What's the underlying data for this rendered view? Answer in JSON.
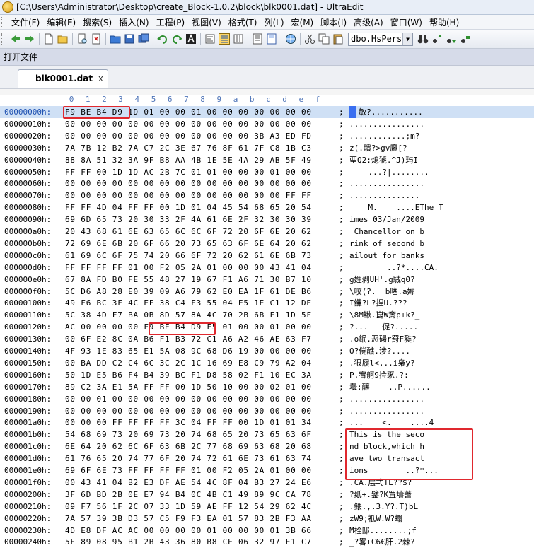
{
  "window": {
    "title": "[C:\\Users\\Administrator\\Desktop\\create_Block-1.0.2\\block\\blk0001.dat] - UltraEdit",
    "icon": "ultraedit-app-icon"
  },
  "menu": [
    {
      "label": "文件(F)",
      "icon": "file-menu-icon"
    },
    {
      "label": "编辑(E)"
    },
    {
      "label": "搜索(S)"
    },
    {
      "label": "插入(N)"
    },
    {
      "label": "工程(P)"
    },
    {
      "label": "视图(V)"
    },
    {
      "label": "格式(T)"
    },
    {
      "label": "列(L)"
    },
    {
      "label": "宏(M)"
    },
    {
      "label": "脚本(I)"
    },
    {
      "label": "高级(A)"
    },
    {
      "label": "窗口(W)"
    },
    {
      "label": "帮助(H)"
    }
  ],
  "toolbar": {
    "combo_value": "dbo.HsPerso"
  },
  "panel_label": "打开文件",
  "tab": {
    "label": "blk0001.dat",
    "close": "x"
  },
  "column_headers": [
    "0",
    "1",
    "2",
    "3",
    "4",
    "5",
    "6",
    "7",
    "8",
    "9",
    "a",
    "b",
    "c",
    "d",
    "e",
    "f"
  ],
  "hex_rows": [
    {
      "addr": "00000000h:",
      "bytes": "F9 BE B4 D9 1D 01 00 00 01 00 00 00 00 00 00 00",
      "ascii": "  敏?..........."
    },
    {
      "addr": "00000010h:",
      "bytes": "00 00 00 00 00 00 00 00 00 00 00 00 00 00 00 00",
      "ascii": "................"
    },
    {
      "addr": "00000020h:",
      "bytes": "00 00 00 00 00 00 00 00 00 00 00 00 3B A3 ED FD",
      "ascii": "............;m?"
    },
    {
      "addr": "00000030h:",
      "bytes": "7A 7B 12 B2 7A C7 2C 3E 67 76 8F 61 7F C8 1B C3",
      "ascii": "z(.瞶?>gv廲[?"
    },
    {
      "addr": "00000040h:",
      "bytes": "88 8A 51 32 3A 9F B8 AA 4B 1E 5E 4A 29 AB 5F 49",
      "ascii": "垔Q2:熄猇.^J)玙I"
    },
    {
      "addr": "00000050h:",
      "bytes": "FF FF 00 1D 1D AC 2B 7C 01 01 00 00 00 01 00 00",
      "ascii": "    ...?|........"
    },
    {
      "addr": "00000060h:",
      "bytes": "00 00 00 00 00 00 00 00 00 00 00 00 00 00 00 00",
      "ascii": "................"
    },
    {
      "addr": "00000070h:",
      "bytes": "00 00 00 00 00 00 00 00 00 00 00 00 00 00 FF FF",
      "ascii": "..............."
    },
    {
      "addr": "00000080h:",
      "bytes": "FF FF 4D 04 FF FF 00 1D 01 04 45 54 68 65 20 54",
      "ascii": "    M.    ....EThe T"
    },
    {
      "addr": "00000090h:",
      "bytes": "69 6D 65 73 20 30 33 2F 4A 61 6E 2F 32 30 30 39",
      "ascii": "imes 03/Jan/2009"
    },
    {
      "addr": "000000a0h:",
      "bytes": "20 43 68 61 6E 63 65 6C 6C 6F 72 20 6F 6E 20 62",
      "ascii": " Chancellor on b"
    },
    {
      "addr": "000000b0h:",
      "bytes": "72 69 6E 6B 20 6F 66 20 73 65 63 6F 6E 64 20 62",
      "ascii": "rink of second b"
    },
    {
      "addr": "000000c0h:",
      "bytes": "61 69 6C 6F 75 74 20 66 6F 72 20 62 61 6E 6B 73",
      "ascii": "ailout for banks"
    },
    {
      "addr": "000000d0h:",
      "bytes": "FF FF FF FF 01 00 F2 05 2A 01 00 00 00 43 41 04",
      "ascii": "        ..?*....CA."
    },
    {
      "addr": "000000e0h:",
      "bytes": "67 8A FD B0 FE 55 48 27 19 67 F1 A6 71 30 B7 10",
      "ascii": "g娌剥UH'.g駥q0?"
    },
    {
      "addr": "000000f0h:",
      "bytes": "5C D6 A8 28 E0 39 09 A6 79 62 E0 EA 1F 61 DE B6",
      "ascii": "\\咬(?.  b噻.a嫭"
    },
    {
      "addr": "00000100h:",
      "bytes": "49 F6 BC 3F 4C EF 38 C4 F3 55 04 E5 1E C1 12 DE",
      "ascii": "I雦?L?捏U.???"
    },
    {
      "addr": "00000110h:",
      "bytes": "5C 38 4D F7 BA 0B 8D 57 8A 4C 70 2B 6B F1 1D 5F",
      "ascii": "\\8M鰍.崑W奝p+k?_"
    },
    {
      "addr": "00000120h:",
      "bytes": "AC 00 00 00 00 F9 BE B4 D9 F5 01 00 00 01 00 00",
      "ascii": "?...   促?....."
    },
    {
      "addr": "00000130h:",
      "bytes": "00 6F E2 8C 0A B6 F1 B3 72 C1 A6 A2 46 AE 63 F7",
      "ascii": ".o鈱.恶碭r罸F甤?"
    },
    {
      "addr": "00000140h:",
      "bytes": "4F 93 1E 83 65 E1 5A 08 9C 68 D6 19 00 00 00 00",
      "ascii": "O?傥醮.涉?...."
    },
    {
      "addr": "00000150h:",
      "bytes": "00 BA DD C2 C4 6C 3C 2C 1C 16 69 E8 C9 79 A2 04",
      "ascii": ".狠履l<,..i枭y?"
    },
    {
      "addr": "00000160h:",
      "bytes": "50 1D E5 B6 F4 B4 39 BC F1 D8 58 02 F1 10 EC 3A",
      "ascii": "P.宥舸9捡豖.?:"
    },
    {
      "addr": "00000170h:",
      "bytes": "89 C2 3A E1 5A FF FF 00 1D 50 10 00 00 02 01 00",
      "ascii": "壜:醸    ..P......"
    },
    {
      "addr": "00000180h:",
      "bytes": "00 00 01 00 00 00 00 00 00 00 00 00 00 00 00 00",
      "ascii": "................"
    },
    {
      "addr": "00000190h:",
      "bytes": "00 00 00 00 00 00 00 00 00 00 00 00 00 00 00 00",
      "ascii": "................"
    },
    {
      "addr": "000001a0h:",
      "bytes": "00 00 00 FF FF FF FF 3C 04 FF FF 00 1D 01 01 34",
      "ascii": "...    <.    ....4"
    },
    {
      "addr": "000001b0h:",
      "bytes": "54 68 69 73 20 69 73 20 74 68 65 20 73 65 63 6F",
      "ascii": "This is the seco"
    },
    {
      "addr": "000001c0h:",
      "bytes": "6E 64 20 62 6C 6F 63 6B 2C 77 68 69 63 68 20 68",
      "ascii": "nd block,which h"
    },
    {
      "addr": "000001d0h:",
      "bytes": "61 76 65 20 74 77 6F 20 74 72 61 6E 73 61 63 74",
      "ascii": "ave two transact"
    },
    {
      "addr": "000001e0h:",
      "bytes": "69 6F 6E 73 FF FF FF FF 01 00 F2 05 2A 01 00 00",
      "ascii": "ions        ..?*..."
    },
    {
      "addr": "000001f0h:",
      "bytes": "00 43 41 04 B2 E3 DF AE 54 4C 8F 04 B3 27 24 E6",
      "ascii": ".CA.层弌TL??$?"
    },
    {
      "addr": "00000200h:",
      "bytes": "3F 6D BD 2B 0E E7 94 B4 0C 4B C1 49 89 9C CA 78",
      "ascii": "?纸+.鐾?K罝壔蓍"
    },
    {
      "addr": "00000210h:",
      "bytes": "09 F7 56 1F 2C 07 33 1D 59 AE FF 12 54 29 62 4C",
      "ascii": ".鳂.,.3.Y?.T)bL"
    },
    {
      "addr": "00000220h:",
      "bytes": "7A 57 39 3B D3 57 C5 F9 F3 EA 01 57 83 2B F3 AA",
      "ascii": "zW9;祗W.W?蠮"
    },
    {
      "addr": "00000230h:",
      "bytes": "4D E8 DF AC AC 00 00 00 00 01 00 00 00 01 3B 66",
      "ascii": "M栓邸........;f"
    },
    {
      "addr": "00000240h:",
      "bytes": "5F 89 08 95 B1 2B 43 36 80 B8 CE 06 32 97 E1 C7",
      "ascii": "_?畧+C6€肝.2棘?"
    }
  ]
}
